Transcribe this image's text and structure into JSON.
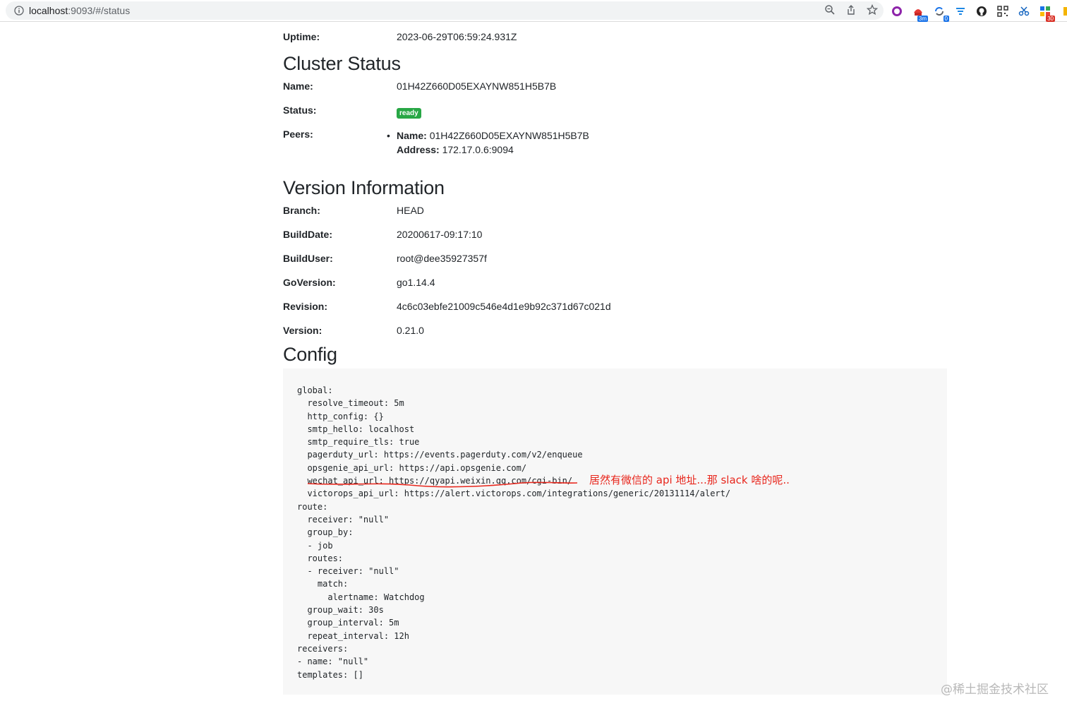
{
  "browser": {
    "url_host": "localhost",
    "url_rest": ":9093/#/status",
    "extension_badges": {
      "ext3": "3m",
      "ext4": "0",
      "ext10": "30"
    }
  },
  "uptime": {
    "label": "Uptime:",
    "value": "2023-06-29T06:59:24.931Z"
  },
  "cluster": {
    "title": "Cluster Status",
    "name_label": "Name:",
    "name_value": "01H42Z660D05EXAYNW851H5B7B",
    "status_label": "Status:",
    "status_value": "ready",
    "peers_label": "Peers:",
    "peer_name_label": "Name:",
    "peer_name_value": "01H42Z660D05EXAYNW851H5B7B",
    "peer_address_label": "Address:",
    "peer_address_value": "172.17.0.6:9094"
  },
  "version": {
    "title": "Version Information",
    "rows": [
      {
        "label": "Branch:",
        "value": "HEAD"
      },
      {
        "label": "BuildDate:",
        "value": "20200617-09:17:10"
      },
      {
        "label": "BuildUser:",
        "value": "root@dee35927357f"
      },
      {
        "label": "GoVersion:",
        "value": "go1.14.4"
      },
      {
        "label": "Revision:",
        "value": "4c6c03ebfe21009c546e4d1e9b92c371d67c021d"
      },
      {
        "label": "Version:",
        "value": "0.21.0"
      }
    ]
  },
  "config": {
    "title": "Config",
    "lines": [
      "global:",
      "  resolve_timeout: 5m",
      "  http_config: {}",
      "  smtp_hello: localhost",
      "  smtp_require_tls: true",
      "  pagerduty_url: https://events.pagerduty.com/v2/enqueue",
      "  opsgenie_api_url: https://api.opsgenie.com/",
      "  wechat_api_url: https://qyapi.weixin.qq.com/cgi-bin/",
      "  victorops_api_url: https://alert.victorops.com/integrations/generic/20131114/alert/",
      "route:",
      "  receiver: \"null\"",
      "  group_by:",
      "  - job",
      "  routes:",
      "  - receiver: \"null\"",
      "    match:",
      "      alertname: Watchdog",
      "  group_wait: 30s",
      "  group_interval: 5m",
      "  repeat_interval: 12h",
      "receivers:",
      "- name: \"null\"",
      "templates: []"
    ]
  },
  "annotation": "居然有微信的 api 地址...那 slack 啥的呢..",
  "watermark": "@稀土掘金技术社区",
  "colors": {
    "ready_badge": "#28a745",
    "annotation": "#e8261c",
    "config_bg": "#f7f7f7"
  }
}
